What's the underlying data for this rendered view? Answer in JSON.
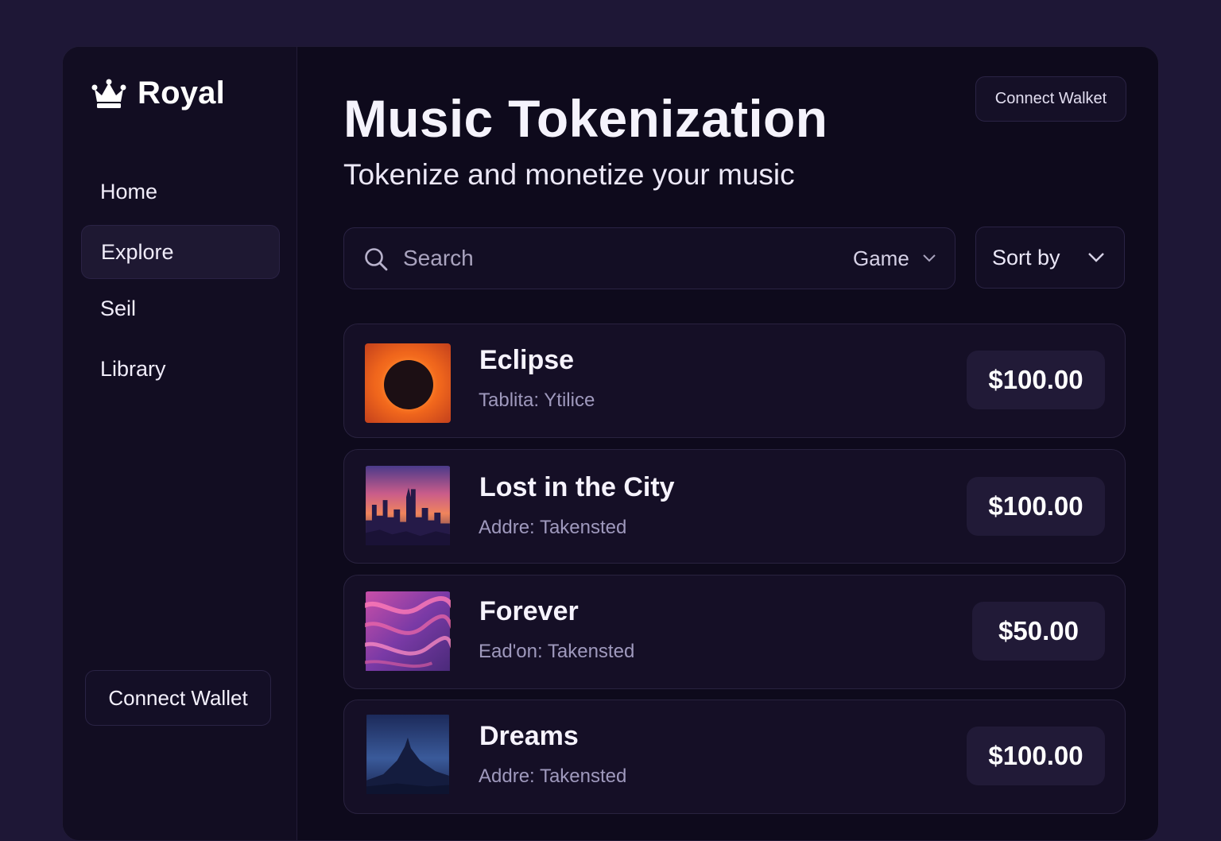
{
  "brand": {
    "name": "Royal",
    "icon": "crown-icon"
  },
  "sidebar": {
    "items": [
      {
        "label": "Home",
        "active": false
      },
      {
        "label": "Explore",
        "active": true
      },
      {
        "label": "Seil",
        "active": false
      },
      {
        "label": "Library",
        "active": false
      }
    ],
    "connect_label": "Connect Wallet"
  },
  "header": {
    "title": "Music Tokenization",
    "subtitle": "Tokenize and monetize your music",
    "connect_label": "Connect Walket"
  },
  "search": {
    "placeholder": "Search",
    "value": "",
    "icon": "search-icon"
  },
  "filter": {
    "selected": "Game",
    "icon": "chevron-down-icon"
  },
  "sort": {
    "label": "Sort by",
    "icon": "chevron-down-icon"
  },
  "tracks": [
    {
      "title": "Eclipse",
      "artist": "Tablita: Ytilice",
      "price": "$100.00",
      "cover": "eclipse-cover"
    },
    {
      "title": "Lost in the City",
      "artist": "Addre: Takensted",
      "price": "$100.00",
      "cover": "city-skyline-cover"
    },
    {
      "title": "Forever",
      "artist": "Ead'on: Takensted",
      "price": "$50.00",
      "cover": "swirl-cover"
    },
    {
      "title": "Dreams",
      "artist": "Addre:  Takensted",
      "price": "$100.00",
      "cover": "mountain-cover"
    }
  ],
  "colors": {
    "background": "#1e1736",
    "panel": "#0e0a1c",
    "sidebar": "#120d22",
    "card": "#150f26",
    "price_badge": "#211a37",
    "muted_text": "#9f99bd"
  }
}
